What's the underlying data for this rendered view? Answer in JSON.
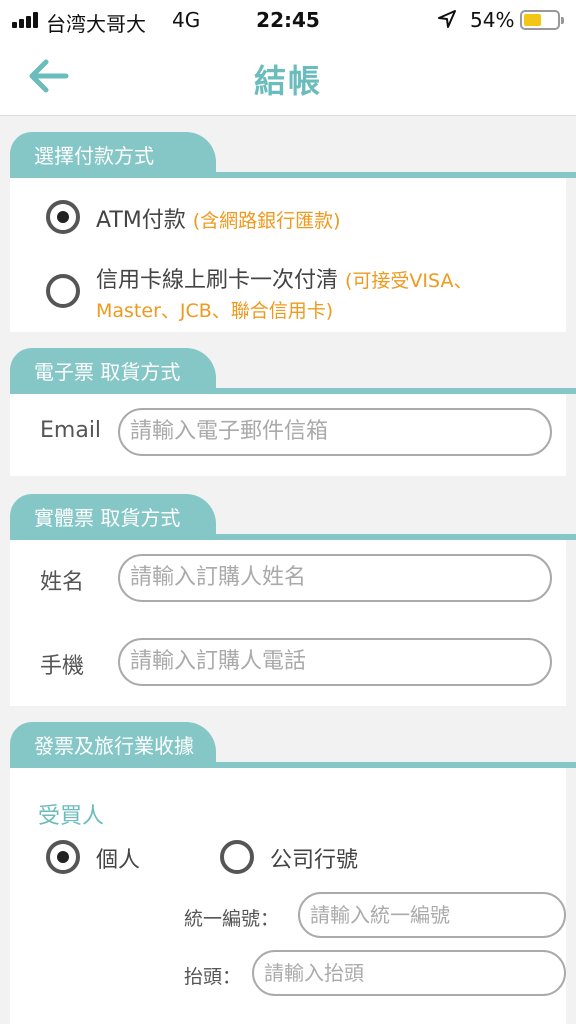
{
  "status": {
    "carrier": "台湾大哥大",
    "network": "4G",
    "time": "22:45",
    "battery": "54%",
    "battery_level": 0.54
  },
  "nav": {
    "title": "結帳",
    "back_icon": "arrow-left-icon"
  },
  "payment": {
    "header": "選擇付款方式",
    "options": [
      {
        "label": "ATM付款",
        "note": "(含網路銀行匯款)",
        "selected": true
      },
      {
        "label": "信用卡線上刷卡一次付清",
        "note_line1": "(可接受VISA、",
        "note_line2": "Master、JCB、聯合信用卡)",
        "selected": false
      }
    ]
  },
  "eticket": {
    "header": "電子票 取貨方式",
    "email_label": "Email",
    "email_placeholder": "請輸入電子郵件信箱"
  },
  "physical": {
    "header": "實體票 取貨方式",
    "name_label": "姓名",
    "name_placeholder": "請輸入訂購人姓名",
    "phone_label": "手機",
    "phone_placeholder": "請輸入訂購人電話"
  },
  "invoice": {
    "header": "發票及旅行業收據",
    "buyer_label": "受買人",
    "personal_label": "個人",
    "company_label": "公司行號",
    "personal_selected": true,
    "tax_id_label": "統一編號：",
    "tax_id_placeholder": "請輸入統一編號",
    "title_label": "抬頭：",
    "title_placeholder": "請輸入抬頭"
  },
  "colors": {
    "accent": "#85c7c7",
    "title": "#6bbcbc",
    "note": "#ef9a1e"
  }
}
